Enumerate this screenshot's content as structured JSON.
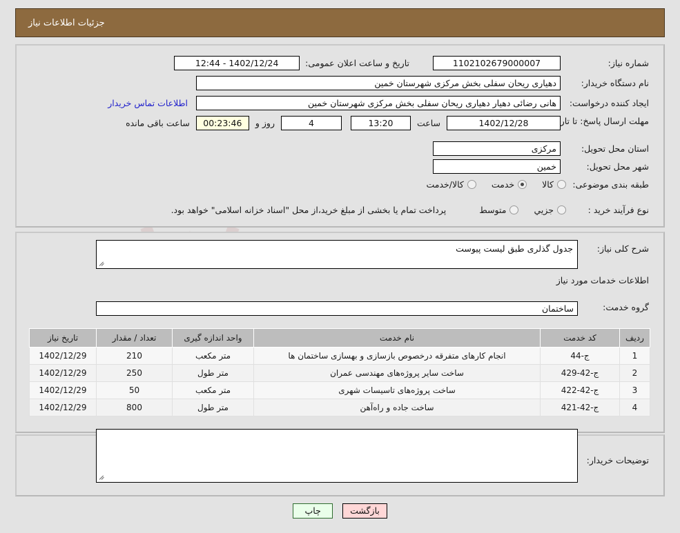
{
  "header": {
    "title": "جزئیات اطلاعات نیاز"
  },
  "form": {
    "need_number_label": "شماره نیاز:",
    "need_number_value": "1102102679000007",
    "announce_label": "تاریخ و ساعت اعلان عمومی:",
    "announce_value": "12:44 - 1402/12/24",
    "buyer_org_label": "نام دستگاه خریدار:",
    "buyer_org_value": "دهیاری ریحان سفلی بخش مرکزی شهرستان خمین",
    "creator_label": "ایجاد کننده درخواست:",
    "creator_value": "هانی رضائی دهیار دهیاری ریحان سفلی بخش مرکزی شهرستان خمین",
    "contact_link": "اطلاعات تماس خریدار",
    "deadline_label": "مهلت ارسال پاسخ: تا تاریخ:",
    "deadline_date": "1402/12/28",
    "hour_label": "ساعت",
    "deadline_time": "13:20",
    "days_value": "4",
    "days_label": "روز و",
    "countdown_value": "00:23:46",
    "remaining_label": "ساعت باقی مانده",
    "province_label": "استان محل تحویل:",
    "province_value": "مرکزی",
    "city_label": "شهر محل تحویل:",
    "city_value": "خمین",
    "category_label": "طبقه بندی موضوعی:",
    "category_options": [
      {
        "label": "کالا",
        "selected": false
      },
      {
        "label": "خدمت",
        "selected": true
      },
      {
        "label": "کالا/خدمت",
        "selected": false
      }
    ],
    "process_label": "نوع فرآیند خرید :",
    "process_options": [
      {
        "label": "جزیي",
        "selected": false
      },
      {
        "label": "متوسط",
        "selected": false
      }
    ],
    "process_note": "پرداخت تمام یا بخشی از مبلغ خرید،از محل \"اسناد خزانه اسلامی\" خواهد بود."
  },
  "middle": {
    "general_desc_label": "شرح کلی نیاز:",
    "general_desc_value": "جدول گذلری طبق لیست پیوست",
    "services_info_title": "اطلاعات خدمات مورد نیاز",
    "service_group_label": "گروه خدمت:",
    "service_group_value": "ساختمان"
  },
  "table": {
    "headers": [
      "ردیف",
      "کد خدمت",
      "نام خدمت",
      "واحد اندازه گیری",
      "تعداد / مقدار",
      "تاریخ نیاز"
    ],
    "rows": [
      {
        "no": "1",
        "code": "ج-44",
        "name": "انجام کارهای متفرقه درخصوص بازسازی و بهسازی ساختمان ها",
        "unit": "متر مکعب",
        "qty": "210",
        "date": "1402/12/29"
      },
      {
        "no": "2",
        "code": "ج-42-429",
        "name": "ساخت سایر پروژه‌های مهندسی عمران",
        "unit": "متر طول",
        "qty": "250",
        "date": "1402/12/29"
      },
      {
        "no": "3",
        "code": "ج-42-422",
        "name": "ساخت پروژه‌های تاسیسات شهری",
        "unit": "متر مکعب",
        "qty": "50",
        "date": "1402/12/29"
      },
      {
        "no": "4",
        "code": "ج-42-421",
        "name": "ساخت جاده و راه‌آهن",
        "unit": "متر طول",
        "qty": "800",
        "date": "1402/12/29"
      }
    ]
  },
  "bottom": {
    "buyer_notes_label": "توضیحات خریدار:",
    "buyer_notes_value": ""
  },
  "actions": {
    "print_label": "چاپ",
    "back_label": "بازگشت"
  },
  "watermark": {
    "text": "AriaTender.net"
  },
  "colors": {
    "header_bg": "#8d6a3f",
    "page_bg": "#e3e3e3",
    "link": "#2222cc",
    "print_btn": "#eaffea",
    "back_btn": "#ffd7d7",
    "countdown_bg": "#ffffe0",
    "table_header_bg": "#bdbdbd"
  }
}
